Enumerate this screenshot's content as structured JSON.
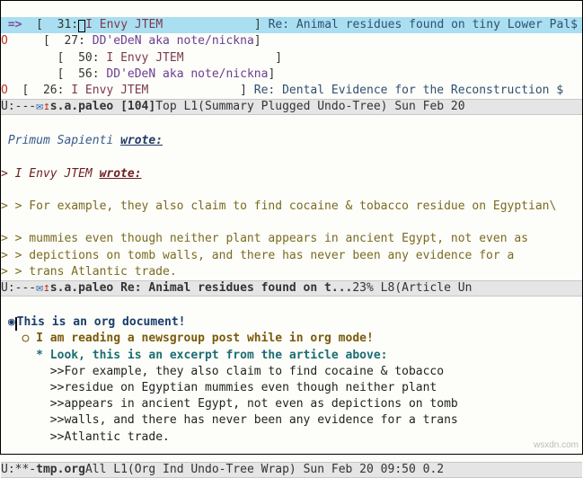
{
  "summary": {
    "selected": {
      "marker": "=>",
      "bracket_l": "[",
      "num": "31",
      "colon": ":",
      "from": "I Envy JTEM",
      "bracket_r": "]",
      "subject": "Re: Animal residues found on tiny Lower Pal$"
    },
    "rows": [
      {
        "indent": "     ",
        "marker": "O",
        "num": "27",
        "from": "DD'eDeN aka note/nickna"
      },
      {
        "indent": "        ",
        "marker": " ",
        "num": "50",
        "from_me": "I Envy JTEM"
      },
      {
        "indent": "        ",
        "marker": " ",
        "num": "56",
        "from": "DD'eDeN aka note/nickna"
      }
    ],
    "last": {
      "marker": "O",
      "num": "26",
      "from_me": "I Envy JTEM",
      "subject": "Re: Dental Evidence for the Reconstruction $"
    }
  },
  "modeline1": {
    "left": " U:--- ",
    "buf": "s.a.paleo [104]",
    "pos": "   Top L1",
    "right": "    (Summary Plugged Undo-Tree) Sun Feb 20"
  },
  "article": {
    "attr_name": "Primum Sapienti",
    "attr_verb": "wrote:",
    "me_name": "I Envy JTEM",
    "me_verb": "wrote:",
    "lines": [
      "> > For example, they also claim to find cocaine & tobacco residue on Egyptian\\",
      "",
      "> > mummies even though neither plant appears in ancient Egypt, not even as",
      "> > depictions on tomb walls, and there has never been any evidence for a",
      "> > trans Atlantic trade."
    ]
  },
  "modeline2": {
    "left": " U:--- ",
    "buf": "s.a.paleo Re: Animal residues found on t...",
    "pos": "   23% L8",
    "right": "      (Article Un"
  },
  "org": {
    "h1": "This is an org document!",
    "h2": "I am reading a newsgroup post while in org mode!",
    "h3": "Look, this is an excerpt from the article above:",
    "body": [
      ">>For example, they also claim to find cocaine & tobacco",
      ">>residue on Egyptian mummies even though neither plant",
      ">>appears in ancient Egypt, not even as depictions on tomb",
      ">>walls, and there has never been any evidence for a trans",
      ">>Atlantic trade."
    ]
  },
  "modeline3": {
    "left": " U:**- ",
    "buf": "tmp.org",
    "pos": "       All L1",
    "right": "    (Org Ind Undo-Tree Wrap) Sun Feb 20 09:50 0.2"
  },
  "watermark": "wsxdn.com"
}
